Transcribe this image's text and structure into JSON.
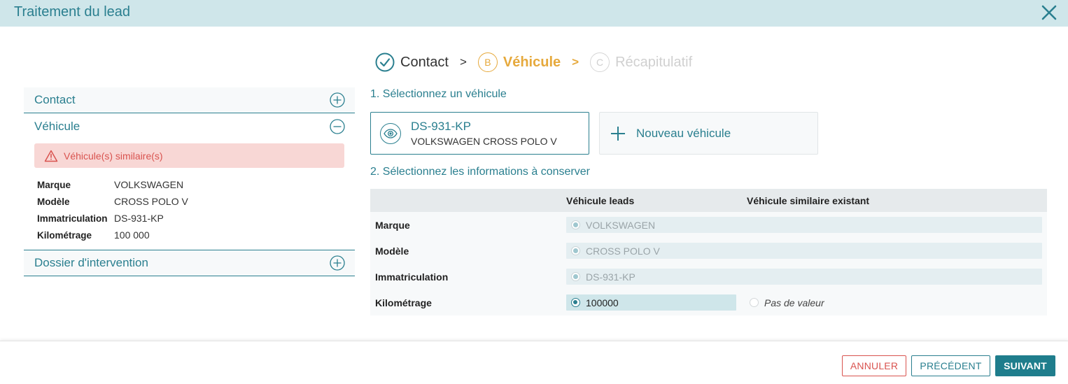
{
  "header": {
    "title": "Traitement du lead"
  },
  "stepper": {
    "steps": [
      {
        "letter": "",
        "label": "Contact",
        "state": "done"
      },
      {
        "letter": "B",
        "label": "Véhicule",
        "state": "active"
      },
      {
        "letter": "C",
        "label": "Récapitulatif",
        "state": "todo"
      }
    ],
    "separator": ">"
  },
  "left_panel": {
    "sections": [
      {
        "title": "Contact",
        "expanded": false
      },
      {
        "title": "Véhicule",
        "expanded": true
      },
      {
        "title": "Dossier d'intervention",
        "expanded": false
      }
    ],
    "alert": "Véhicule(s) similaire(s)",
    "vehicle_info": [
      {
        "label": "Marque",
        "value": "VOLKSWAGEN"
      },
      {
        "label": "Modèle",
        "value": "CROSS POLO V"
      },
      {
        "label": "Immatriculation",
        "value": "DS-931-KP"
      },
      {
        "label": "Kilométrage",
        "value": "100 000"
      }
    ]
  },
  "main": {
    "step1_title": "1. Sélectionnez un véhicule",
    "selected_vehicle": {
      "plate": "DS-931-KP",
      "model": "VOLKSWAGEN CROSS POLO V"
    },
    "new_vehicle_label": "Nouveau véhicule",
    "step2_title": "2. Sélectionnez les informations à conserver",
    "table": {
      "headers": [
        "",
        "Véhicule leads",
        "Véhicule similaire existant"
      ],
      "rows": [
        {
          "label": "Marque",
          "lead_value": "VOLKSWAGEN"
        },
        {
          "label": "Modèle",
          "lead_value": "CROSS POLO V"
        },
        {
          "label": "Immatriculation",
          "lead_value": "DS-931-KP"
        },
        {
          "label": "Kilométrage",
          "lead_value": "100000",
          "existing_value": "Pas de valeur"
        }
      ]
    }
  },
  "footer": {
    "cancel_label": "ANNULER",
    "prev_label": "PRÉCÉDENT",
    "next_label": "SUIVANT"
  },
  "colors": {
    "primary": "#2a7f8f",
    "accent": "#e6a93c",
    "danger": "#d9534f",
    "header_bg": "#cfe6ea"
  }
}
